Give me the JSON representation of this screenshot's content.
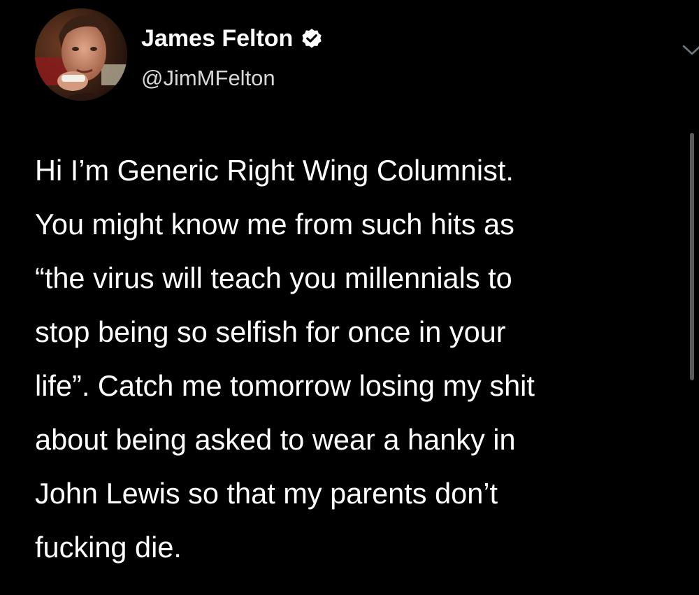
{
  "author": {
    "display_name": "James Felton",
    "handle": "@JimMFelton",
    "verified": true,
    "verified_icon": "verified-badge-icon",
    "avatar": "profile-photo"
  },
  "menu_icon": "chevron-down-icon",
  "tweet": {
    "lines": [
      "Hi I’m Generic Right Wing Columnist.",
      "You might know me from such hits as",
      "“the virus will teach you millennials to",
      "stop being so selfish for once in your",
      "life”. Catch me tomorrow losing my shit",
      "about being asked to wear a hanky in",
      "John Lewis so that my parents don’t",
      "fucking die."
    ]
  },
  "colors": {
    "background": "#000000",
    "text": "#ffffff",
    "handle": "#d8d8d8",
    "muted_icon": "#6e767d",
    "scrollbar": "#5a5a5a"
  }
}
